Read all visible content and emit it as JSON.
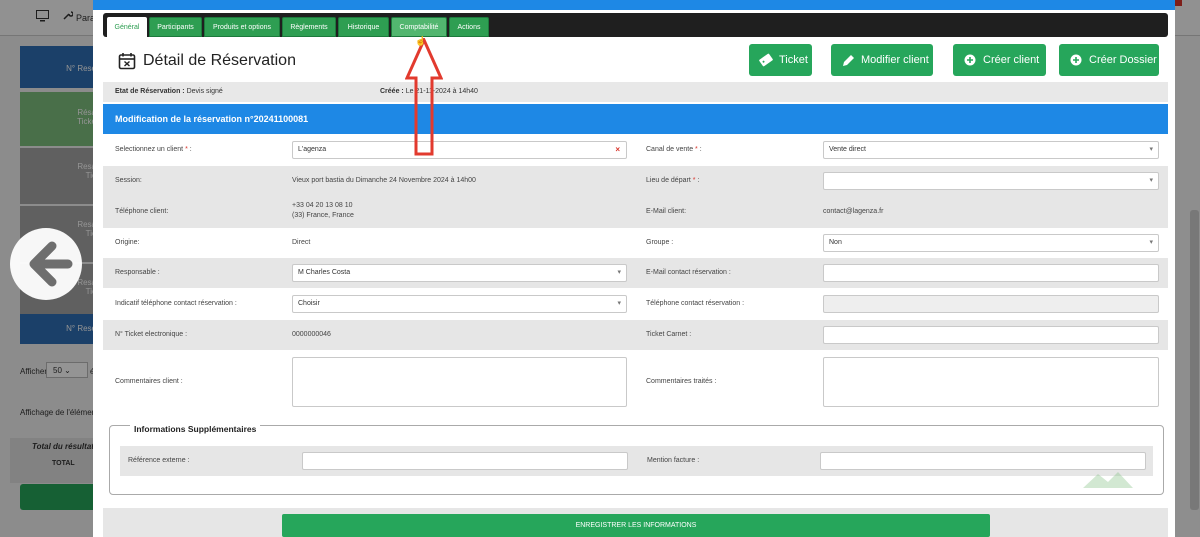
{
  "colors": {
    "brand_blue": "#1e88e5",
    "button_green": "#26a65b",
    "tab_green": "#2e9e52",
    "annotation_red": "#e23a2e"
  },
  "background": {
    "toolbar_label": "Para",
    "left_items": [
      {
        "text": "N° Rese",
        "sub": ""
      },
      {
        "text": "Résa",
        "sub": "Ticke"
      },
      {
        "text": "Resa",
        "sub": "Tic"
      },
      {
        "text": "Resa",
        "sub": "Tic"
      },
      {
        "text": "Resa",
        "sub": "Tic"
      },
      {
        "text": "N° Rese",
        "sub": ""
      }
    ],
    "show_label": "Afficher",
    "show_value": "50",
    "show_suffix": "é",
    "display_label": "Affichage de l'élément 1",
    "total_header": "Total du résultat d",
    "total_label": "TOTAL"
  },
  "modal": {
    "tabs": [
      "Général",
      "Participants",
      "Produits et options",
      "Règlements",
      "Historique",
      "Comptabilité",
      "Actions"
    ],
    "title": "Détail de Réservation",
    "buttons": {
      "ticket": "Ticket",
      "edit_client": "Modifier client",
      "create_client": "Créer client",
      "create_folder": "Créer Dossier"
    },
    "status": {
      "label": "Etat de Réservation :",
      "value": "Devis signé",
      "created_label": "Créée :",
      "created_value": "Le 21-11-2024 à 14h40"
    },
    "section_title": "Modification de la réservation n°20241100081",
    "fields": {
      "client_label": "Selectionnez un client",
      "client_value": "L'agenza",
      "canal_label": "Canal de vente",
      "canal_value": "Vente direct",
      "session_label": "Session:",
      "session_value": "Vieux port bastia du Dimanche 24 Novembre 2024 à 14h00",
      "depart_label": "Lieu de départ",
      "depart_value": "",
      "phone_label": "Téléphone client:",
      "phone_line1": "+33 04 20 13 08 10",
      "phone_line2": "(33) France, France",
      "email_label": "E-Mail client:",
      "email_value": "contact@lagenza.fr",
      "origin_label": "Origine:",
      "origin_value": "Direct",
      "group_label": "Groupe :",
      "group_value": "Non",
      "resp_label": "Responsable :",
      "resp_value": "M Charles Costa",
      "email_contact_label": "E-Mail contact réservation :",
      "email_contact_value": "",
      "indicatif_label": "Indicatif téléphone contact réservation :",
      "indicatif_value": "Choisir",
      "tel_contact_label": "Téléphone contact réservation :",
      "tel_contact_value": "",
      "ticket_elec_label": "N° Ticket electronique :",
      "ticket_elec_value": "0000000046",
      "ticket_carnet_label": "Ticket Carnet :",
      "ticket_carnet_value": "",
      "comments_client_label": "Commentaires client :",
      "comments_traites_label": "Commentaires traités :"
    },
    "info": {
      "title": "Informations Supplémentaires",
      "ref_label": "Référence externe :",
      "mention_label": "Mention facture :"
    },
    "save_label": "ENREGISTRER LES INFORMATIONS"
  }
}
